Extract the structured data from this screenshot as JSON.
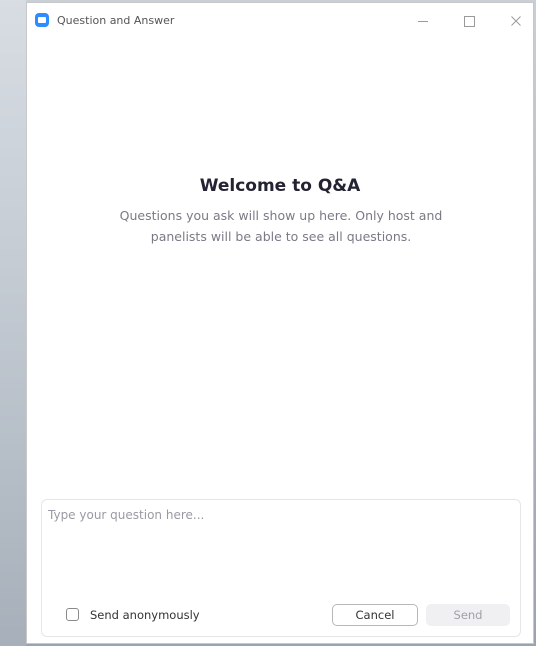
{
  "window": {
    "title": "Question and Answer",
    "accent_color": "#2d8cff",
    "icon": "zoom-app-icon"
  },
  "titlebar_controls": {
    "minimize_icon": "minimize-icon",
    "maximize_icon": "maximize-icon",
    "close_icon": "close-icon"
  },
  "welcome": {
    "title": "Welcome to Q&A",
    "subtitle": "Questions you ask will show up here. Only host and panelists will be able to see all questions."
  },
  "compose": {
    "placeholder": "Type your question here...",
    "value": "",
    "anonymous_label": "Send anonymously",
    "anonymous_checked": false,
    "cancel_label": "Cancel",
    "send_label": "Send"
  }
}
